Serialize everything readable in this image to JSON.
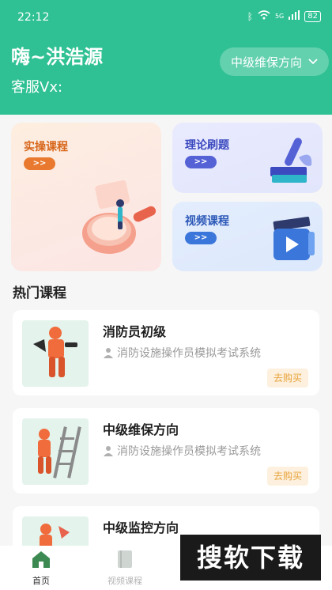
{
  "status_bar": {
    "time": "22:12",
    "signal_label": "5G",
    "battery": "82"
  },
  "header": {
    "greeting": "嗨~洪浩源",
    "service": "客服Vx:",
    "direction_select": "中级维保方向"
  },
  "cards": {
    "practical": {
      "title": "实操课程",
      "go": ">>"
    },
    "theory": {
      "title": "理论刷题",
      "go": ">>"
    },
    "video": {
      "title": "视频课程",
      "go": ">>"
    }
  },
  "section_title": "热门课程",
  "courses": [
    {
      "name": "消防员初级",
      "subtitle": "消防设施操作员模拟考试系统",
      "buy": "去购买"
    },
    {
      "name": "中级维保方向",
      "subtitle": "消防设施操作员模拟考试系统",
      "buy": "去购买"
    },
    {
      "name": "中级监控方向"
    }
  ],
  "tabbar": {
    "home": "首页",
    "video": "视频课程"
  },
  "watermark": "搜软下载",
  "colors": {
    "brand": "#2fc193",
    "buy_bg": "#fdf0de",
    "buy_text": "#e8a33b"
  }
}
